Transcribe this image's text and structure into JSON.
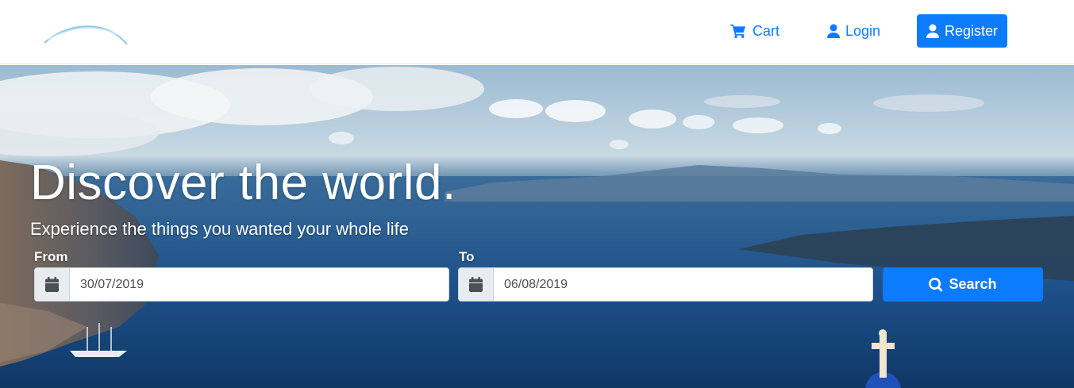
{
  "nav": {
    "cart_label": "Cart",
    "login_label": "Login",
    "register_label": "Register",
    "icons": {
      "cart": "cart-icon",
      "login": "user-icon",
      "register": "user-icon"
    }
  },
  "hero": {
    "title": "Discover the world.",
    "subtitle": "Experience the things you wanted your whole life"
  },
  "search": {
    "from_label": "From",
    "from_value": "30/07/2019",
    "to_label": "To",
    "to_value": "06/08/2019",
    "button_label": "Search",
    "icons": {
      "date": "calendar-icon",
      "button": "search-icon"
    }
  },
  "colors": {
    "accent": "#0d7bff",
    "addon_bg": "#e9ecef",
    "text_dark": "#495057"
  }
}
